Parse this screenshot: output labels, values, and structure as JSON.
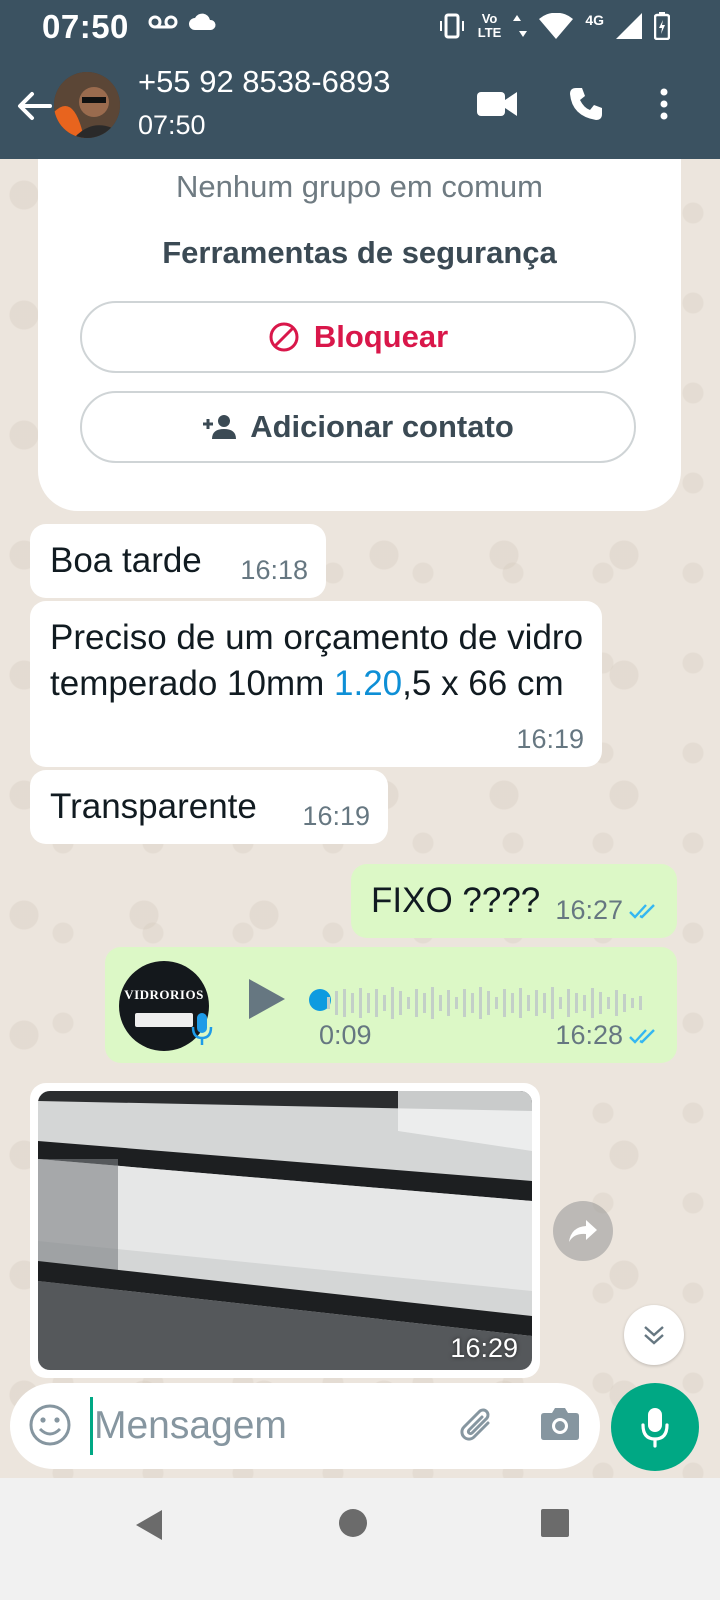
{
  "status_bar": {
    "time": "07:50",
    "volte": "Vo",
    "lte": "LTE",
    "network": "4G"
  },
  "header": {
    "contact_name": "+55 92 8538-6893",
    "subtitle": "07:50"
  },
  "info_card": {
    "no_groups": "Nenhum grupo em comum",
    "safety_tools": "Ferramentas de segurança",
    "block_label": "Bloquear",
    "add_contact_label": "Adicionar contato"
  },
  "messages": [
    {
      "direction": "in",
      "text": "Boa tarde",
      "time": "16:18"
    },
    {
      "direction": "in",
      "text_before": "Preciso de um orçamento de vidro temperado 10mm ",
      "link": "1.20",
      "text_after": ",5 x 66 cm",
      "time": "16:19"
    },
    {
      "direction": "in",
      "text": "Transparente",
      "time": "16:19"
    },
    {
      "direction": "out",
      "text": "FIXO ????",
      "time": "16:27",
      "status": "read"
    },
    {
      "direction": "out",
      "type": "voice",
      "avatar_text": "VIDRORIOS",
      "duration": "0:09",
      "time": "16:28",
      "progress": 0.0,
      "status": "read"
    },
    {
      "direction": "in",
      "type": "image",
      "time": "16:29"
    }
  ],
  "composer": {
    "placeholder": "Mensagem"
  },
  "colors": {
    "header_bg": "#3b5261",
    "accent": "#00a884",
    "outgoing_bubble": "#dcf8c6",
    "read_ticks": "#34b7f1",
    "block_red": "#d9174a",
    "link_blue": "#0e8fd6"
  }
}
